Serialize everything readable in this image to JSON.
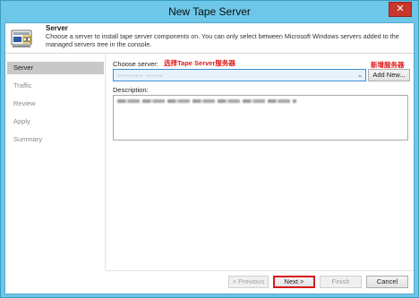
{
  "window": {
    "title": "New Tape Server",
    "close_glyph": "✕"
  },
  "header": {
    "title": "Server",
    "description": "Choose a server to install tape server components on. You can only select between Microsoft Windows servers added to the managed servers tree in the console.",
    "icon": "tape-server-icon"
  },
  "steps": [
    {
      "label": "Server",
      "active": true
    },
    {
      "label": "Traffic",
      "active": false
    },
    {
      "label": "Review",
      "active": false
    },
    {
      "label": "Apply",
      "active": false
    },
    {
      "label": "Summary",
      "active": false
    }
  ],
  "form": {
    "choose_label": "Choose server:",
    "choose_annotation": "选择Tape Server服务器",
    "add_annotation": "新增服务器",
    "selected_server": "~~~~~~ ~~~~",
    "add_new_label": "Add New...",
    "description_label": "Description:",
    "arrow_glyph": "⌄"
  },
  "buttons": {
    "previous": "< Previous",
    "next": "Next >",
    "finish": "Finish",
    "cancel": "Cancel"
  },
  "colors": {
    "title_bar": "#6cc7e8",
    "close_button": "#c9362c",
    "annotation": "#e01818",
    "active_step": "#c8c8c8"
  }
}
